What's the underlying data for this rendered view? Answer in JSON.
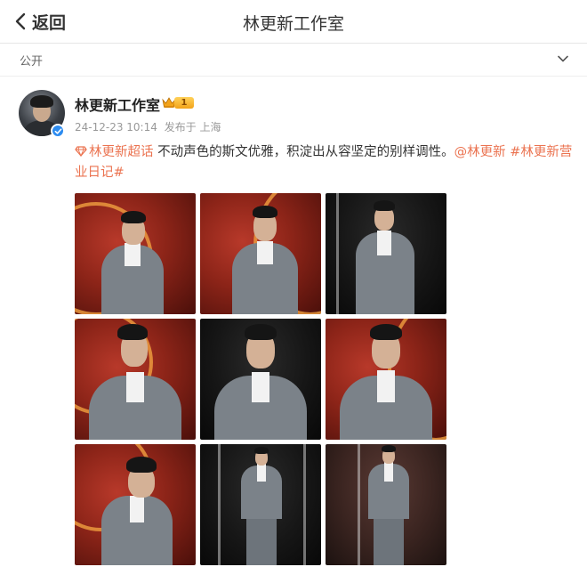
{
  "header": {
    "back_label": "返回",
    "title": "林更新工作室"
  },
  "visibility": {
    "label": "公开"
  },
  "author": {
    "name": "林更新工作室",
    "level": "1",
    "timestamp": "24-12-23 10:14",
    "location": "发布于 上海"
  },
  "post": {
    "topic": "林更新超话",
    "text": " 不动声色的斯文优雅，积淀出从容坚定的别样调性。",
    "mention": "@林更新",
    "hashtag": "#林更新营业日记#"
  },
  "colors": {
    "link": "#eb7350",
    "verified": "#2d8cf0",
    "badge": "#f3a31a"
  },
  "icons": {
    "back": "chevron-left-icon",
    "visibility_toggle": "chevron-down-icon",
    "verified": "verified-badge-icon",
    "crown": "crown-icon",
    "topic": "diamond-topic-icon"
  }
}
